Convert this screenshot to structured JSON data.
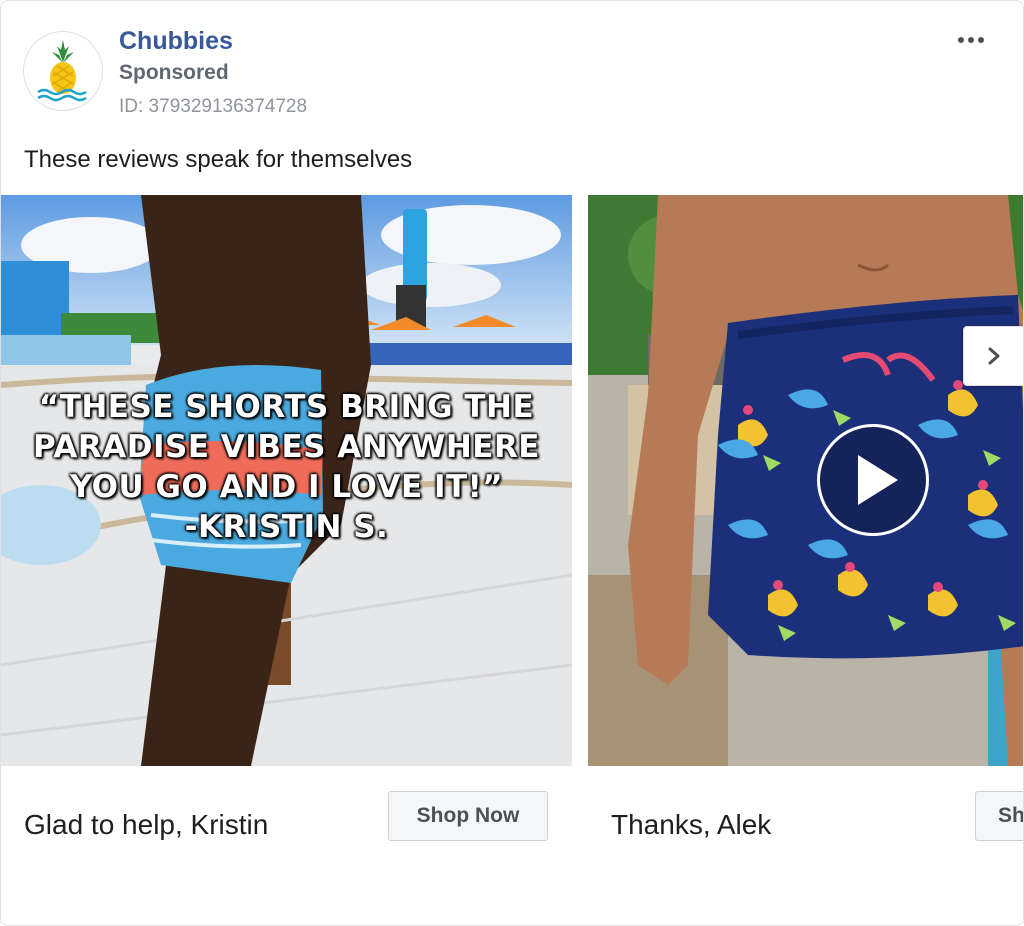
{
  "ad": {
    "brand": "Chubbies",
    "sponsored": "Sponsored",
    "ad_id": "ID: 379329136374728",
    "caption": "These reviews speak for themselves"
  },
  "cards": [
    {
      "overlay_quote": [
        "“THESE SHORTS BRING THE",
        "PARADISE VIBES ANYWHERE",
        "YOU GO AND I LOVE IT!”",
        "-KRISTIN S."
      ],
      "title": "Glad to help, Kristin",
      "cta": "Shop Now"
    },
    {
      "title": "Thanks, Alek",
      "cta": "Sh"
    }
  ],
  "icons": {
    "logo": "pineapple-logo-icon",
    "more": "more-options-icon",
    "play": "play-icon",
    "next": "chevron-right-icon"
  },
  "colors": {
    "brand_name": "#385898",
    "secondary_text": "#606770",
    "id_text": "#90949c",
    "cta_background": "#f5f6f7"
  }
}
